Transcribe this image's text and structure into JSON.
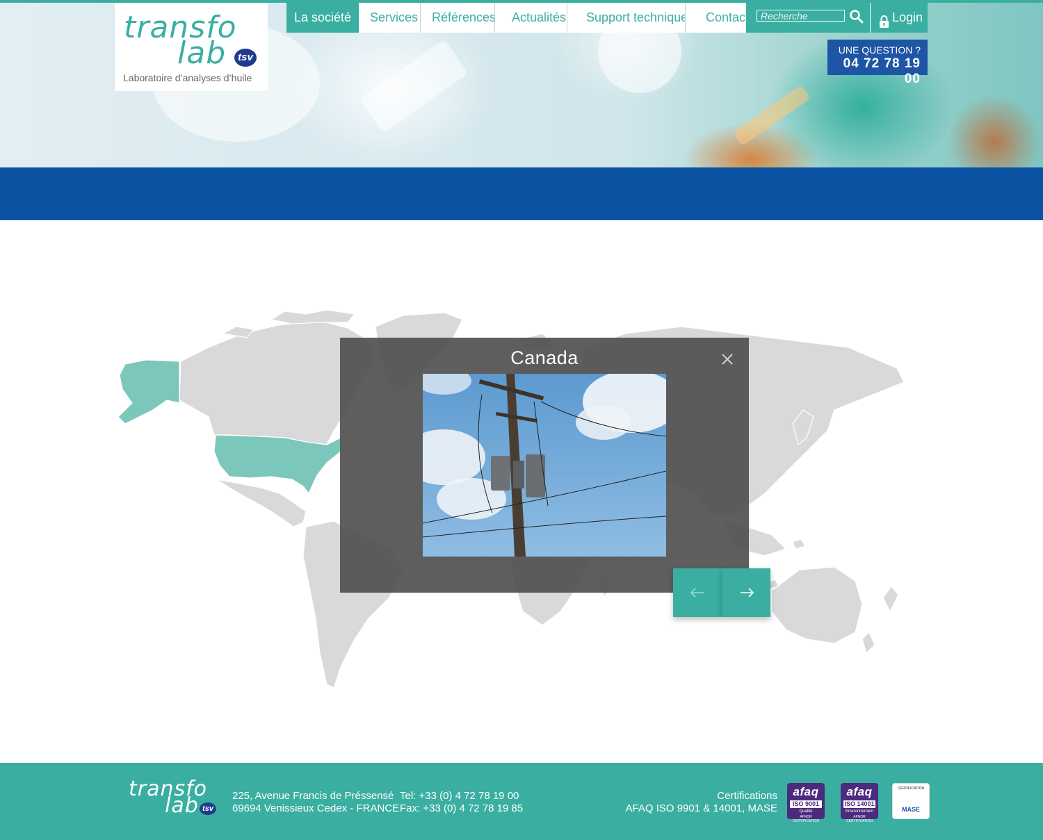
{
  "header": {
    "logo": {
      "word1": "transfo",
      "word2": "lab",
      "badge": "tsv",
      "tagline": "Laboratoire d’analyses d’huile"
    },
    "nav": [
      {
        "label": "La société",
        "active": true
      },
      {
        "label": "Services",
        "active": false
      },
      {
        "label": "Références",
        "active": false
      },
      {
        "label": "Actualités",
        "active": false
      },
      {
        "label": "Support technique",
        "active": false
      },
      {
        "label": "Contact",
        "active": false
      }
    ],
    "search": {
      "placeholder": "Recherche",
      "value": "",
      "icon": "search-icon"
    },
    "login": {
      "label": "Login",
      "icon": "lock-icon"
    },
    "question": {
      "label": "UNE QUESTION ?",
      "phone": "04 72 78 19 00"
    }
  },
  "map": {
    "highlighted_regions": [
      "Alaska",
      "United States"
    ],
    "highlight_color": "#7cc7bb",
    "land_color": "#d9d9d9"
  },
  "modal": {
    "title": "Canada",
    "close_icon": "close-icon",
    "prev_icon": "arrow-left-icon",
    "next_icon": "arrow-right-icon"
  },
  "footer": {
    "logo": {
      "word1": "transfo",
      "word2": "lab",
      "badge": "tsv"
    },
    "address": [
      "225, Avenue Francis de Préssensé",
      "69694 Venissieux Cedex - FRANCE"
    ],
    "phone": [
      "Tel: +33 (0) 4 72 78 19 00",
      "Fax: +33 (0) 4 72 78 19 85"
    ],
    "certifications": [
      "Certifications",
      "AFAQ ISO 9901 & 14001, MASE"
    ],
    "badges": [
      {
        "brand": "afaq",
        "standard": "ISO 9001",
        "scope": "Qualité",
        "issuer": "AFNOR CERTIFICATION"
      },
      {
        "brand": "afaq",
        "standard": "ISO 14001",
        "scope": "Environnement",
        "issuer": "AFNOR CERTIFICATION"
      },
      {
        "brand": "CERTIFICATION",
        "standard": "MASE"
      }
    ]
  },
  "colors": {
    "accent": "#3aafa1",
    "blue": "#0a52a2",
    "question_bg": "#1f55a5"
  }
}
